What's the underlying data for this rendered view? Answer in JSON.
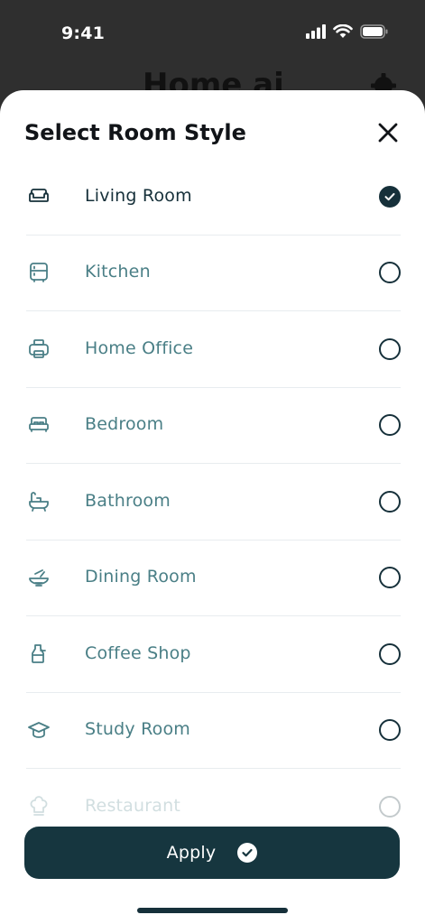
{
  "status_bar": {
    "time": "9:41"
  },
  "background": {
    "title": "Home ai"
  },
  "sheet": {
    "title": "Select Room Style",
    "items": [
      {
        "label": "Living Room",
        "icon": "sofa-icon",
        "selected": true
      },
      {
        "label": "Kitchen",
        "icon": "fridge-icon",
        "selected": false
      },
      {
        "label": "Home Office",
        "icon": "printer-icon",
        "selected": false
      },
      {
        "label": "Bedroom",
        "icon": "bed-icon",
        "selected": false
      },
      {
        "label": "Bathroom",
        "icon": "bathtub-icon",
        "selected": false
      },
      {
        "label": "Dining Room",
        "icon": "dish-icon",
        "selected": false
      },
      {
        "label": "Coffee Shop",
        "icon": "coffee-maker-icon",
        "selected": false
      },
      {
        "label": "Study Room",
        "icon": "graduation-cap-icon",
        "selected": false
      },
      {
        "label": "Restaurant",
        "icon": "chef-hat-icon",
        "selected": false
      }
    ],
    "apply_label": "Apply"
  },
  "colors": {
    "primary": "#16363f",
    "label_teal": "#4a7f86",
    "sheet_bg": "#ffffff",
    "backdrop": "#2f2f2f"
  }
}
